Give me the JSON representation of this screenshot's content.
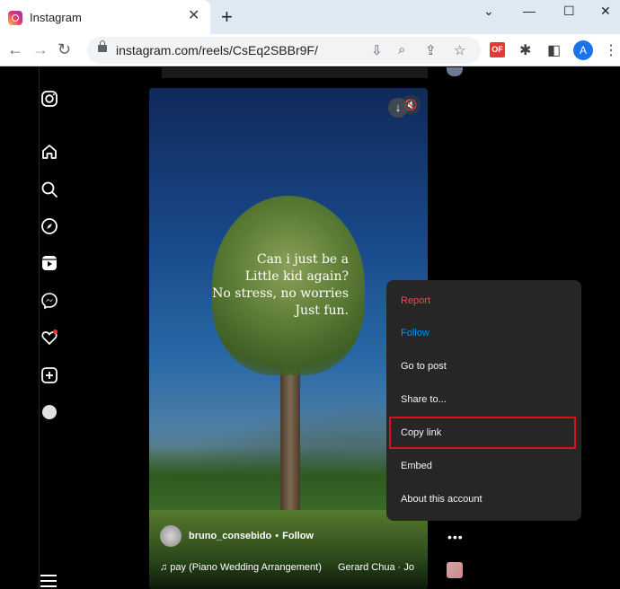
{
  "browser": {
    "tab_title": "Instagram",
    "tab_close": "✕",
    "new_tab": "+",
    "url": "instagram.com/reels/CsEq2SBBr9F/",
    "ext_label": "OF",
    "profile_initial": "A",
    "window_controls": [
      "⌄",
      "—",
      "☐",
      "✕"
    ]
  },
  "reel": {
    "caption_lines": "Can i just  be a\nLittle kid again?\nNo stress, no worries\nJust fun.",
    "username": "bruno_consebido",
    "separator": "•",
    "follow_label": "Follow",
    "audio_title": "♫ pay (Piano Wedding Arrangement)",
    "audio_artist": "Gerard Chua · Jo"
  },
  "popup_menu": {
    "items": [
      {
        "label": "Report"
      },
      {
        "label": "Follow"
      },
      {
        "label": "Go to post"
      },
      {
        "label": "Share to..."
      },
      {
        "label": "Copy link"
      },
      {
        "label": "Embed"
      },
      {
        "label": "About this account"
      }
    ]
  },
  "colors": {
    "report": "#ed4956",
    "follow": "#0095f6",
    "highlight": "#e0101a"
  },
  "icons": {
    "sidebar": [
      "instagram-logo-icon",
      "home-icon",
      "search-icon",
      "explore-icon",
      "reels-icon",
      "messenger-icon",
      "notifications-icon",
      "create-icon",
      "profile-avatar",
      "more-menu-icon"
    ]
  }
}
